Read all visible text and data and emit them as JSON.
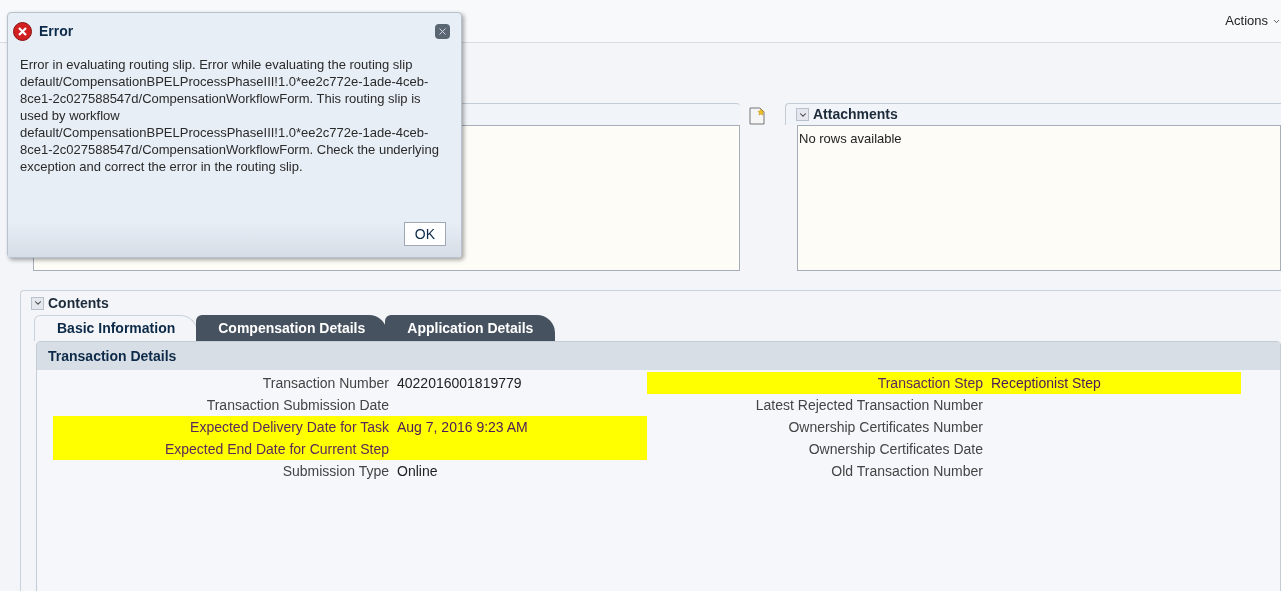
{
  "toolbar": {
    "actions_label": "Actions"
  },
  "dialog": {
    "title": "Error",
    "message": "Error in evaluating routing slip. Error while evaluating the routing slip default/CompensationBPELProcessPhaseIII!1.0*ee2c772e-1ade-4ceb-8ce1-2c027588547d/CompensationWorkflowForm. This routing slip is used by workflow default/CompensationBPELProcessPhaseIII!1.0*ee2c772e-1ade-4ceb-8ce1-2c027588547d/CompensationWorkflowForm. Check the underlying exception and correct the error in the routing slip.",
    "ok_label": "OK"
  },
  "attachments": {
    "title": "Attachments",
    "expanded": true,
    "empty_text": "No rows available"
  },
  "contents": {
    "title": "Contents",
    "expanded": true,
    "tabs": [
      {
        "label": "Basic Information",
        "selected": true
      },
      {
        "label": "Compensation Details",
        "selected": false
      },
      {
        "label": "Application Details",
        "selected": false
      }
    ],
    "section_title": "Transaction Details",
    "left_fields": [
      {
        "label": "Transaction Number",
        "value": "4022016001819779",
        "highlighted": false
      },
      {
        "label": "Transaction Submission Date",
        "highlighted": false
      },
      {
        "label": "Expected Delivery Date for Task",
        "value": "Aug 7, 2016 9:23 AM",
        "highlighted": true
      },
      {
        "label": "Expected End Date for Current Step",
        "highlighted": true
      },
      {
        "label": "Submission Type",
        "value": "Online",
        "highlighted": false
      }
    ],
    "right_fields": [
      {
        "label": "Transaction Step",
        "value": "Receptionist Step",
        "highlighted": true
      },
      {
        "label": "Latest Rejected Transaction Number",
        "highlighted": false
      },
      {
        "label": "Ownership Certificates Number",
        "highlighted": false
      },
      {
        "label": "Ownership Certificates Date",
        "highlighted": false
      },
      {
        "label": "Old Transaction Number",
        "highlighted": false
      }
    ]
  }
}
